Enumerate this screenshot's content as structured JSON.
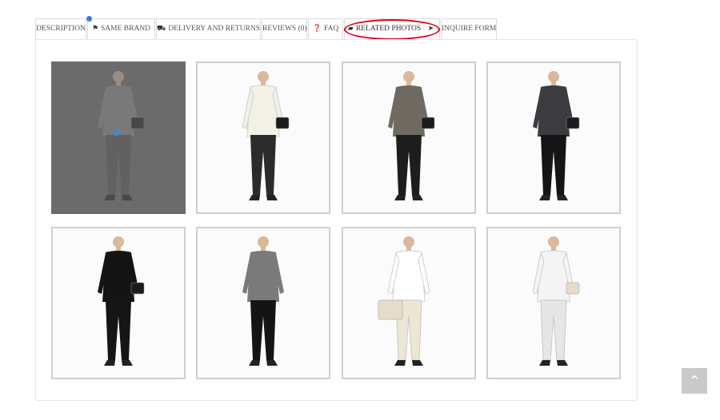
{
  "tabs": [
    {
      "label": "DESCRIPTION",
      "icon": ""
    },
    {
      "label": "SAME BRAND",
      "icon": "flag-icon"
    },
    {
      "label": "DELIVERY AND RETURNS",
      "icon": "truck-icon"
    },
    {
      "label": "REVIEWS (0)",
      "icon": ""
    },
    {
      "label": "FAQ",
      "icon": "question-icon"
    },
    {
      "label": "RELATED PHOTOS",
      "icon": "image-icon"
    },
    {
      "label": "INQUIRE FORM",
      "icon": "send-icon"
    }
  ],
  "active_tab": "RELATED PHOTOS",
  "gallery": [
    {
      "id": 1,
      "top": "grey shirt",
      "bottom": "grey trousers",
      "bag": "black clutch",
      "hovered": true
    },
    {
      "id": 2,
      "top": "white ruffle blouse",
      "bottom": "dotted trousers",
      "bag": "black bag"
    },
    {
      "id": 3,
      "top": "printed blouse",
      "bottom": "black cropped trousers",
      "bag": "black bag"
    },
    {
      "id": 4,
      "top": "printed shirt",
      "bottom": "black trousers",
      "bag": "black clutch"
    },
    {
      "id": 5,
      "top": "black blouse",
      "bottom": "black wide trousers",
      "bag": "black clutch"
    },
    {
      "id": 6,
      "top": "metallic shirt",
      "bottom": "black skinny trousers",
      "bag": ""
    },
    {
      "id": 7,
      "top": "white shirt",
      "bottom": "cream trousers",
      "bag": "beige tote"
    },
    {
      "id": 8,
      "top": "sheer white shirt",
      "bottom": "white skinny trousers",
      "bag": "beige bag"
    }
  ],
  "icons": {
    "zoom": "zoom-in-icon",
    "back_to_top": "chevron-up-icon"
  },
  "colors": {
    "annotation": "#e0001a",
    "hover_overlay": "#6b6b6b",
    "zoom_icon": "#3a8ee6",
    "to_top_bg": "#c9c9c9"
  }
}
